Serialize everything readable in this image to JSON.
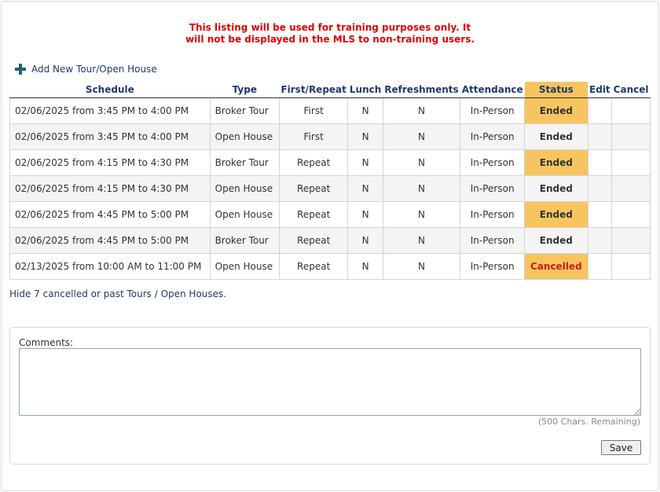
{
  "notice": {
    "line1": "This listing will be used for training purposes only. It",
    "line2": "will not be displayed in the MLS to non-training users."
  },
  "add_tour_label": "Add New Tour/Open House",
  "table": {
    "headers": {
      "schedule": "Schedule",
      "type": "Type",
      "first_repeat": "First/Repeat",
      "lunch": "Lunch",
      "refreshments": "Refreshments",
      "attendance": "Attendance",
      "status": "Status",
      "edit": "Edit",
      "cancel": "Cancel"
    },
    "rows": [
      {
        "schedule": "02/06/2025 from 3:45 PM to 4:00 PM",
        "type": "Broker Tour",
        "first_repeat": "First",
        "lunch": "N",
        "refreshments": "N",
        "attendance": "In-Person",
        "status": "Ended"
      },
      {
        "schedule": "02/06/2025 from 3:45 PM to 4:00 PM",
        "type": "Open House",
        "first_repeat": "First",
        "lunch": "N",
        "refreshments": "N",
        "attendance": "In-Person",
        "status": "Ended"
      },
      {
        "schedule": "02/06/2025 from 4:15 PM to 4:30 PM",
        "type": "Broker Tour",
        "first_repeat": "Repeat",
        "lunch": "N",
        "refreshments": "N",
        "attendance": "In-Person",
        "status": "Ended"
      },
      {
        "schedule": "02/06/2025 from 4:15 PM to 4:30 PM",
        "type": "Open House",
        "first_repeat": "Repeat",
        "lunch": "N",
        "refreshments": "N",
        "attendance": "In-Person",
        "status": "Ended"
      },
      {
        "schedule": "02/06/2025 from 4:45 PM to 5:00 PM",
        "type": "Open House",
        "first_repeat": "Repeat",
        "lunch": "N",
        "refreshments": "N",
        "attendance": "In-Person",
        "status": "Ended"
      },
      {
        "schedule": "02/06/2025 from 4:45 PM to 5:00 PM",
        "type": "Broker Tour",
        "first_repeat": "Repeat",
        "lunch": "N",
        "refreshments": "N",
        "attendance": "In-Person",
        "status": "Ended"
      },
      {
        "schedule": "02/13/2025 from 10:00 AM to 11:00 PM",
        "type": "Open House",
        "first_repeat": "Repeat",
        "lunch": "N",
        "refreshments": "N",
        "attendance": "In-Person",
        "status": "Cancelled"
      }
    ]
  },
  "hide_link": "Hide 7 cancelled or past Tours / Open Houses.",
  "comments": {
    "label": "Comments:",
    "value": "",
    "chars_remaining": "(500 Chars. Remaining)",
    "save_label": "Save"
  },
  "colors": {
    "notice": "#e00000",
    "status_bg": "#f7c55f",
    "cancelled_text": "#d61a1a",
    "header_text": "#1e3a6e"
  },
  "icons": {
    "add": "plus-icon"
  }
}
